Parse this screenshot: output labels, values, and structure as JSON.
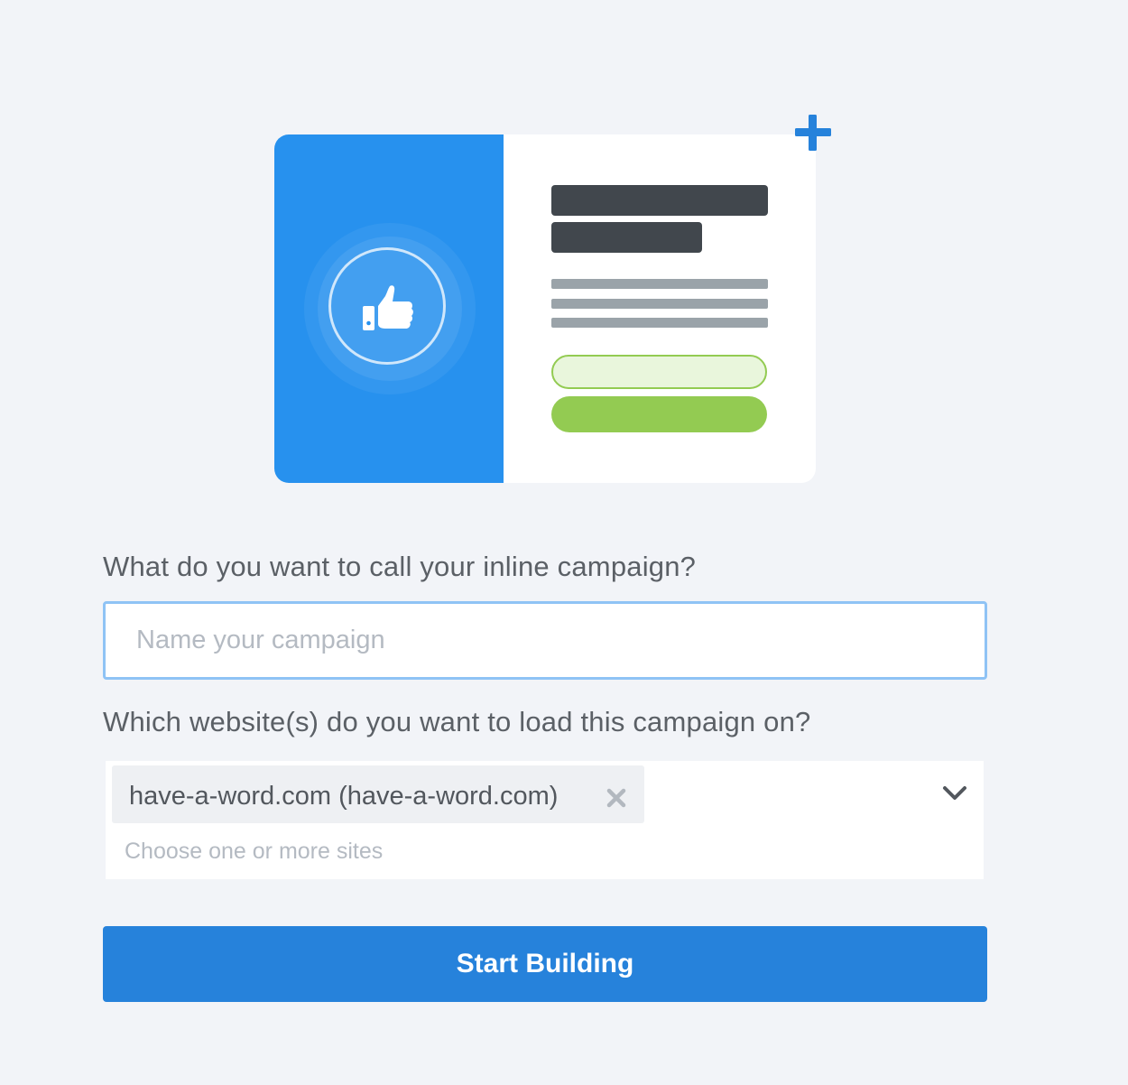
{
  "illustration": {
    "icon": "thumbs-up-icon",
    "add_icon": "plus-icon",
    "colors": {
      "panel_blue": "#2791ee",
      "dark_bar": "#41474d",
      "gray_bar": "#9aa3a9",
      "green": "#93cb52",
      "plus_blue": "#2682db"
    }
  },
  "form": {
    "name_label": "What do you want to call your inline campaign?",
    "name_placeholder": "Name your campaign",
    "name_value": "",
    "sites_label": "Which website(s) do you want to load this campaign on?",
    "selected_sites": [
      {
        "label": "have-a-word.com (have-a-word.com)"
      }
    ],
    "sites_placeholder": "Choose one or more sites",
    "submit_label": "Start Building",
    "colors": {
      "input_focus_border": "#8fc3f5",
      "button": "#2682db",
      "background": "#f2f4f8"
    }
  }
}
